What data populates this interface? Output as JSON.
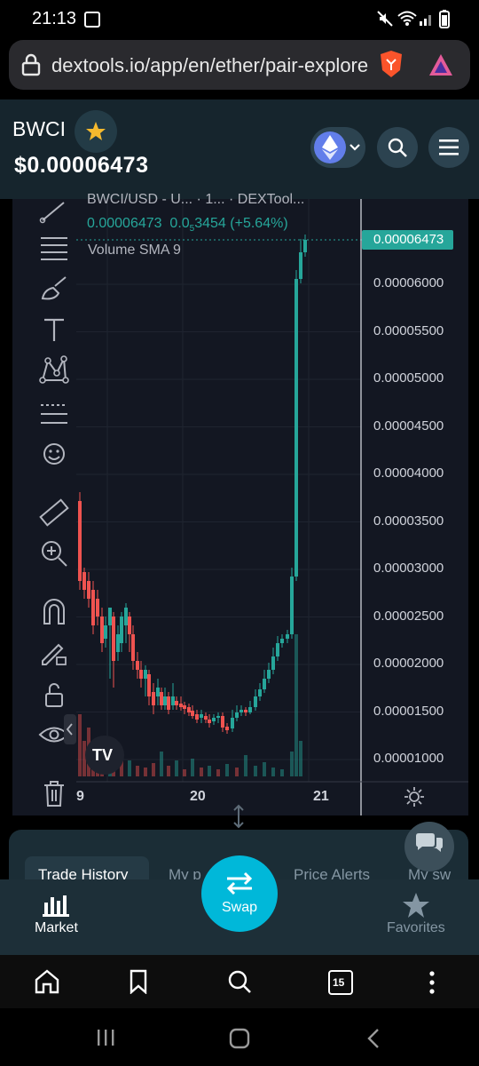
{
  "status_bar": {
    "time": "21:13"
  },
  "browser": {
    "url": "dextools.io/app/en/ether/pair-explore",
    "tab_count": "15"
  },
  "header": {
    "pair_name": "BWCI",
    "price": "$0.00006473"
  },
  "chart": {
    "legend_title": "BWCI/USD - U... · 1... · DEXTool...",
    "legend_price": "0.00006473",
    "legend_change": "0.0",
    "legend_change_sub": "5",
    "legend_change_rest": "3454 (+5.64%)",
    "volume_label": "Volume SMA 9",
    "current_price_tag": "0.00006473",
    "price_axis": [
      "0.00006000",
      "0.00005500",
      "0.00005000",
      "0.00004500",
      "0.00004000",
      "0.00003500",
      "0.00003000",
      "0.00002500",
      "0.00002000",
      "0.00001500",
      "0.00001000"
    ],
    "time_axis": [
      "9",
      "20",
      "21"
    ]
  },
  "tabs": {
    "trade_history": "Trade History",
    "my_positions": "My p",
    "price_alerts": "Price Alerts",
    "my_swaps": "My sw"
  },
  "bottom_nav": {
    "market": "Market",
    "swap": "Swap",
    "favorites": "Favorites"
  },
  "colors": {
    "up": "#26a69a",
    "down": "#ef5350",
    "accent": "#00b8d9",
    "star": "#f5b92e"
  }
}
